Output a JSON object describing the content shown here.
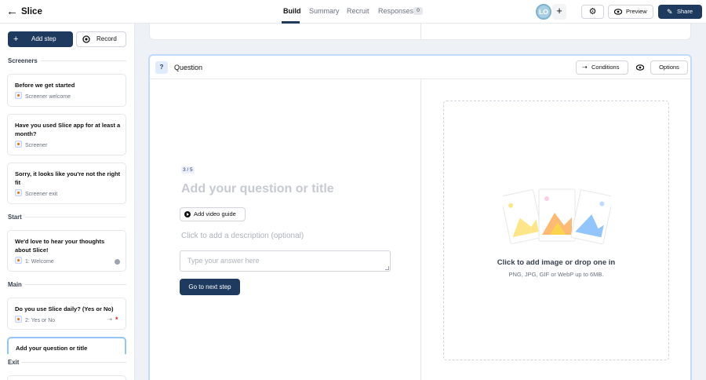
{
  "header": {
    "title": "Slice",
    "tabs": [
      {
        "label": "Build"
      },
      {
        "label": "Summary"
      },
      {
        "label": "Recruit"
      },
      {
        "label": "Responses"
      }
    ],
    "responses_count": "0",
    "avatar_initials": "LO",
    "preview_label": "Preview",
    "share_label": "Share"
  },
  "sidebar": {
    "add_step_label": "Add step",
    "record_label": "Record",
    "sections": {
      "screeners": "Screeners",
      "start": "Start",
      "main": "Main",
      "exit": "Exit"
    },
    "cards": [
      {
        "title": "Before we get started",
        "meta": "Screener welcome"
      },
      {
        "title": "Have you used Slice app for at least a month?",
        "meta": "Screener"
      },
      {
        "title": "Sorry, it looks like you're not the right fit",
        "meta": "Screener exit"
      },
      {
        "title": "We'd love to hear your thoughts about Slice!",
        "meta": "1: Welcome"
      },
      {
        "title": "Do you use Slice daily? (Yes or No)",
        "meta": "2: Yes or No"
      },
      {
        "title": "Add your question or title",
        "meta": ""
      }
    ]
  },
  "question": {
    "header_label": "Question",
    "conditions_label": "Conditions",
    "options_label": "Options",
    "step_counter": "3 / 5",
    "title_placeholder": "Add your question or title",
    "video_guide_label": "Add video guide",
    "description_placeholder": "Click to add a description (optional)",
    "answer_placeholder": "Type your answer here",
    "next_step_label": "Go to next step",
    "drop_title": "Click to add image or drop one in",
    "drop_subtitle": "PNG, JPG, GIF or WebP up to 6MB."
  },
  "colors": {
    "primary": "#1e3a5f",
    "selected_border": "#bfdbfe",
    "warning_star": "#dc2626"
  }
}
